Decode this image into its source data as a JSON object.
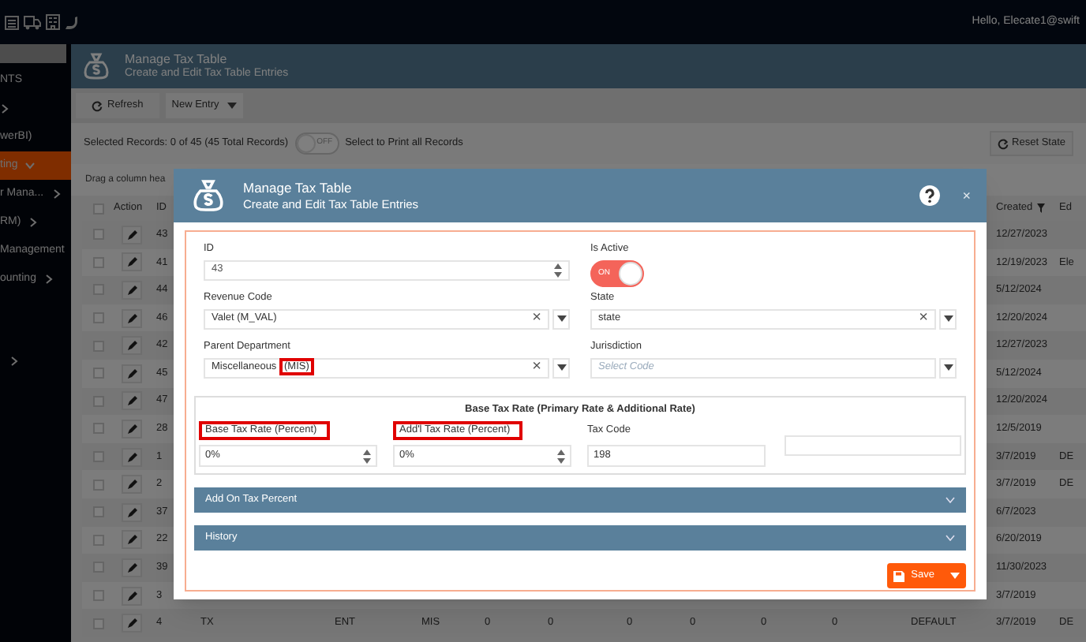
{
  "top_bar": {
    "greeting": "Hello, Elecate1@swift"
  },
  "sidebar": {
    "items": [
      {
        "label": "NTS",
        "selected": false
      },
      {
        "selected": false,
        "expanded": false
      },
      {
        "label": "werBI)",
        "selected": false
      },
      {
        "label": "ting",
        "selected": true,
        "expanded": true
      },
      {
        "label": "r Mana...",
        "selected": false,
        "expanded": false
      },
      {
        "label": "RM)",
        "selected": false,
        "expanded": false
      },
      {
        "label": "Management",
        "selected": false
      },
      {
        "label": "ounting",
        "selected": false,
        "expanded": false
      },
      {
        "selected": false,
        "expanded": false
      }
    ]
  },
  "page_header": {
    "title": "Manage Tax Table",
    "subtitle": "Create and Edit Tax Table Entries"
  },
  "toolbar": {
    "refresh": "Refresh",
    "new_entry": "New Entry"
  },
  "selection_bar": {
    "text": "Selected Records: 0 of 45 (45 Total Records)",
    "toggle": {
      "on": false,
      "text": "OFF"
    },
    "toggle_label": "Select to Print all Records",
    "reset": "Reset State"
  },
  "grid": {
    "group_hint": "Drag a column hea",
    "columns": {
      "action": "Action",
      "id": "ID",
      "created": "Created",
      "column_ed": "Ed"
    },
    "all_checked": false,
    "rows": [
      {
        "checked": false,
        "id": "43",
        "created": "12/27/2023"
      },
      {
        "checked": false,
        "id": "41",
        "created": "12/19/2023",
        "column_ed": "Ele"
      },
      {
        "checked": false,
        "id": "44",
        "created": "5/12/2024"
      },
      {
        "checked": false,
        "id": "46",
        "created": "12/20/2024"
      },
      {
        "checked": false,
        "id": "42",
        "created": "12/27/2023"
      },
      {
        "checked": false,
        "id": "45",
        "created": "5/12/2024"
      },
      {
        "checked": false,
        "id": "47",
        "created": "12/20/2024"
      },
      {
        "checked": false,
        "id": "28",
        "created": "12/5/2019"
      },
      {
        "checked": false,
        "id": "1",
        "created": "3/7/2019",
        "column_ed": "DE"
      },
      {
        "checked": false,
        "id": "2",
        "created": "3/7/2019",
        "column_ed": "DE"
      },
      {
        "checked": false,
        "id": "37",
        "created": "6/7/2023"
      },
      {
        "checked": false,
        "id": "22",
        "created": "6/20/2019"
      },
      {
        "checked": false,
        "id": "39",
        "created": "11/30/2023"
      },
      {
        "checked": false,
        "id": "3",
        "created": "3/7/2019"
      },
      {
        "checked": false,
        "id": "4",
        "created": "3/7/2019",
        "column_ed": "DE",
        "column_4": "TX",
        "column_6": "ENT",
        "column_7": "MIS",
        "column_8": "0",
        "column_9": "0",
        "column_10": "0",
        "column_11": "0",
        "column_12": "0",
        "column_13": "0",
        "column_14": "DEFAULT"
      }
    ]
  },
  "dialog": {
    "title": "Manage Tax Table",
    "subtitle": "Create and Edit Tax Table Entries",
    "close": "×",
    "id": {
      "label": "ID",
      "value": "43"
    },
    "is_active": {
      "label": "Is Active",
      "on": true,
      "text": "ON"
    },
    "revenue_code": {
      "label": "Revenue Code",
      "value": "Valet (M_VAL)",
      "clear": "×"
    },
    "state": {
      "label": "State",
      "value": "state",
      "clear": "×"
    },
    "parent_department": {
      "label": "Parent Department",
      "clear": "×",
      "value_parts": [
        {
          "text": "Miscellaneous ",
          "highlighted": false
        },
        {
          "text": "(MIS)",
          "highlighted": true
        }
      ]
    },
    "jurisdiction": {
      "label": "Jurisdiction",
      "placeholder": "Select Code"
    },
    "base_tax_section": {
      "title": "Base Tax Rate (Primary Rate & Additional Rate)",
      "fields": [
        {
          "kind": "spinner",
          "label": "Base Tax Rate (Percent)",
          "highlighted": true,
          "value": "0%"
        },
        {
          "kind": "spinner",
          "label": "Add'l Tax Rate (Percent)",
          "highlighted": true,
          "value": "0%"
        },
        {
          "kind": "text",
          "label": "Tax Code",
          "highlighted": false,
          "value": "198"
        },
        {
          "kind": "blank"
        }
      ]
    },
    "panels": [
      {
        "title": "Add On Tax Percent",
        "expanded": false
      },
      {
        "title": "History",
        "expanded": false
      }
    ],
    "save": "Save"
  }
}
